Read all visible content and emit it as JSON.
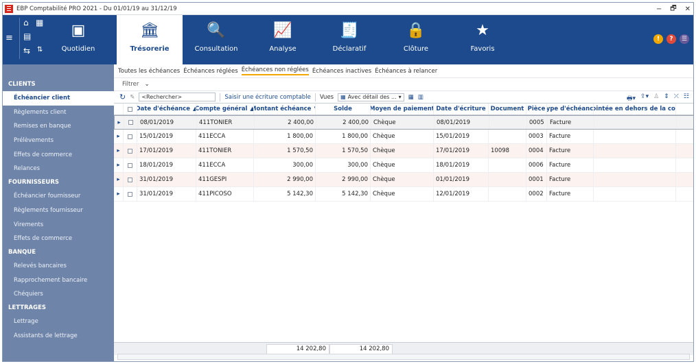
{
  "window": {
    "title": "EBP Comptabilité PRO 2021 - Du 01/01/19 au 31/12/19",
    "controls": [
      "−",
      "🗗",
      "✕"
    ]
  },
  "ribbon": {
    "tabs": [
      {
        "label": "Quotidien",
        "icon": "calendar-icon",
        "glyph": "▣"
      },
      {
        "label": "Trésorerie",
        "icon": "bank-icon",
        "glyph": "🏛"
      },
      {
        "label": "Consultation",
        "icon": "search-document-icon",
        "glyph": "🔍"
      },
      {
        "label": "Analyse",
        "icon": "chart-icon",
        "glyph": "📈"
      },
      {
        "label": "Déclaratif",
        "icon": "tax-document-icon",
        "glyph": "🧾"
      },
      {
        "label": "Clôture",
        "icon": "lock-icon",
        "glyph": "🔒"
      },
      {
        "label": "Favoris",
        "icon": "star-icon",
        "glyph": "★"
      }
    ],
    "active_tab": "Trésorerie",
    "right_icons": [
      {
        "icon": "notification-icon",
        "glyph": "!",
        "color": "#f0a800"
      },
      {
        "icon": "help-icon",
        "glyph": "?",
        "color": "#e04a3a"
      },
      {
        "icon": "user-menu-icon",
        "glyph": "☰",
        "color": "#6a5a9a"
      }
    ]
  },
  "sidebar": {
    "sections": [
      {
        "title": "CLIENTS",
        "items": [
          "Échéancier client",
          "Règlements client",
          "Remises en banque",
          "Prélèvements",
          "Effets de commerce",
          "Relances"
        ]
      },
      {
        "title": "FOURNISSEURS",
        "items": [
          "Échéancier fournisseur",
          "Règlements fournisseur",
          "Virements",
          "Effets de commerce"
        ]
      },
      {
        "title": "BANQUE",
        "items": [
          "Relevés bancaires",
          "Rapprochement bancaire",
          "Chéquiers"
        ]
      },
      {
        "title": "LETTRAGES",
        "items": [
          "Lettrage",
          "Assistants de lettrage"
        ]
      }
    ],
    "active_item": "Échéancier client"
  },
  "subtabs": [
    "Toutes les échéances",
    "Échéances réglées",
    "Échéances non réglées",
    "Échéances inactives",
    "Échéances à relancer"
  ],
  "active_subtab": "Échéances non réglées",
  "filter_label": "Filtrer",
  "toolbar": {
    "search_placeholder": "<Rechercher>",
    "entry_link": "Saisir une écriture comptable",
    "views_label": "Vues",
    "view_select": "Avec détail des ..."
  },
  "table": {
    "columns": [
      "Date d'échéance",
      "Compte général",
      "Montant échéance",
      "Solde",
      "Moyen de paiement",
      "Date d'écriture",
      "Document",
      "Pièce",
      "Type d'échéance",
      "Pointée en dehors de la com"
    ],
    "sort_marks": [
      "▲",
      "▲",
      "▼",
      "",
      "",
      "",
      "",
      "",
      "",
      ""
    ],
    "rows": [
      [
        "08/01/2019",
        "411TONIER",
        "2 400,00",
        "2 400,00",
        "Chèque",
        "08/01/2019",
        "",
        "0005",
        "Facture",
        ""
      ],
      [
        "15/01/2019",
        "411ECCA",
        "1 800,00",
        "1 800,00",
        "Chèque",
        "15/01/2019",
        "",
        "0003",
        "Facture",
        ""
      ],
      [
        "17/01/2019",
        "411TONIER",
        "1 570,50",
        "1 570,50",
        "Chèque",
        "17/01/2019",
        "10098",
        "0004",
        "Facture",
        ""
      ],
      [
        "18/01/2019",
        "411ECCA",
        "300,00",
        "300,00",
        "Chèque",
        "18/01/2019",
        "",
        "0006",
        "Facture",
        ""
      ],
      [
        "31/01/2019",
        "411GESPI",
        "2 990,00",
        "2 990,00",
        "Chèque",
        "01/01/2019",
        "",
        "0001",
        "Facture",
        ""
      ],
      [
        "31/01/2019",
        "411PICOSO",
        "5 142,30",
        "5 142,30",
        "Chèque",
        "12/01/2019",
        "",
        "0002",
        "Facture",
        ""
      ]
    ]
  },
  "totals": {
    "montant": "14 202,80",
    "solde": "14 202,80"
  }
}
